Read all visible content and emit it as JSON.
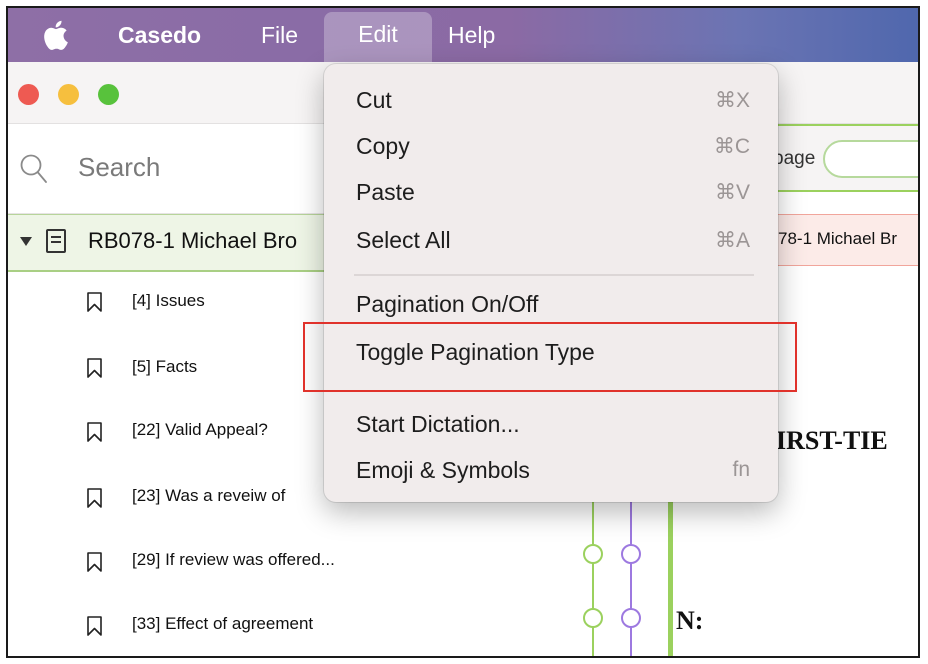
{
  "menubar": {
    "app_name": "Casedo",
    "menus": [
      "File",
      "Edit",
      "Help"
    ]
  },
  "sidebar": {
    "search_placeholder": "Search",
    "root_label": "RB078-1 Michael Bro",
    "items": [
      {
        "label": "[4] Issues"
      },
      {
        "label": "[5] Facts"
      },
      {
        "label": "[22] Valid Appeal?"
      },
      {
        "label": "[23] Was a reveiw of"
      },
      {
        "label": "[29] If review was offered..."
      },
      {
        "label": "[33] Effect of agreement"
      }
    ]
  },
  "right_panel": {
    "page_label": "page",
    "tab_label": "78-1 Michael Br",
    "doc_heading": "IRST-TIE",
    "doc_text_2": "N:"
  },
  "edit_menu": {
    "items": [
      {
        "label": "Cut",
        "shortcut": "⌘X"
      },
      {
        "label": "Copy",
        "shortcut": "⌘C"
      },
      {
        "label": "Paste",
        "shortcut": "⌘V"
      },
      {
        "label": "Select All",
        "shortcut": "⌘A"
      },
      {
        "label": "Pagination On/Off",
        "shortcut": ""
      },
      {
        "label": "Toggle Pagination Type",
        "shortcut": ""
      },
      {
        "label": "Start Dictation...",
        "shortcut": ""
      },
      {
        "label": "Emoji & Symbols",
        "shortcut": "fn"
      }
    ]
  },
  "colors": {
    "menubar_start": "#8e6fa6",
    "menubar_end": "#4f67ad",
    "accent_green": "#9bd15e",
    "accent_purple": "#9d79e0",
    "highlight_red": "#e0322b"
  }
}
